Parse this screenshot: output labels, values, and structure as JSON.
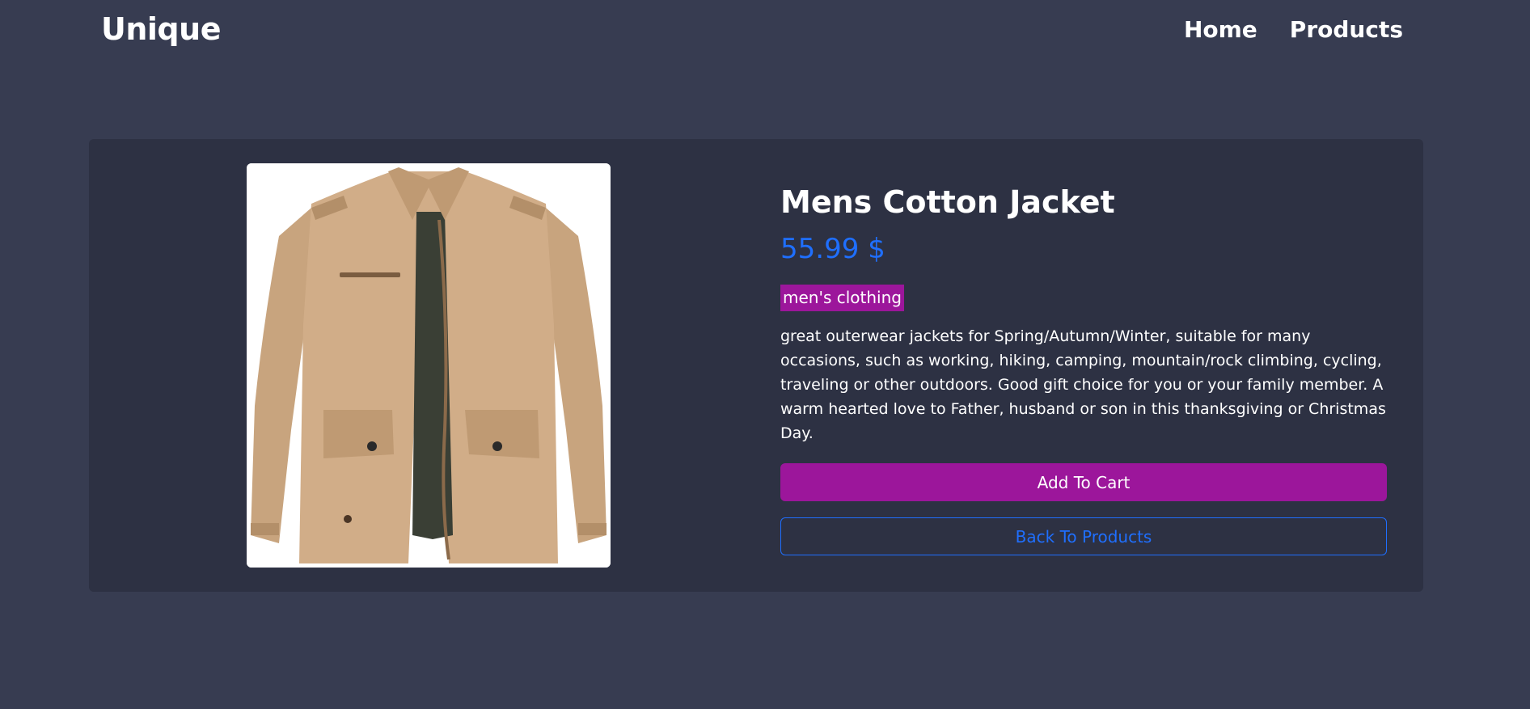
{
  "navbar": {
    "brand": "Unique",
    "links": [
      {
        "label": "Home"
      },
      {
        "label": "Products"
      }
    ]
  },
  "product": {
    "title": "Mens Cotton Jacket",
    "price": "55.99 $",
    "category": "men's clothing",
    "description": "great outerwear jackets for Spring/Autumn/Winter, suitable for many occasions, such as working, hiking, camping, mountain/rock climbing, cycling, traveling or other outdoors. Good gift choice for you or your family member. A warm hearted love to Father, husband or son in this thanksgiving or Christmas Day.",
    "image_subject": "tan cotton jacket"
  },
  "actions": {
    "add_to_cart": "Add To Cart",
    "back_to_products": "Back To Products"
  },
  "colors": {
    "page_background": "#373c51",
    "card_background": "#2d3143",
    "accent_purple": "#9c169b",
    "accent_blue": "#1f6fff"
  }
}
